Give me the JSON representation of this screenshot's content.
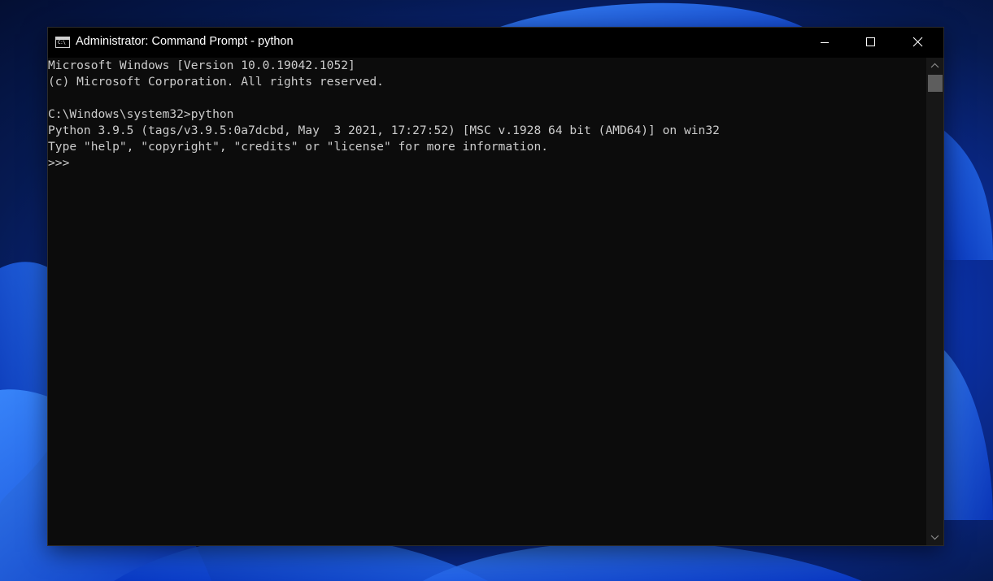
{
  "window": {
    "title": "Administrator: Command Prompt - python",
    "app_icon_text": "C:\\"
  },
  "controls": {
    "minimize_icon": "minimize-icon",
    "maximize_icon": "maximize-icon",
    "close_icon": "close-icon"
  },
  "console": {
    "lines": [
      "Microsoft Windows [Version 10.0.19042.1052]",
      "(c) Microsoft Corporation. All rights reserved.",
      "",
      "C:\\Windows\\system32>python",
      "Python 3.9.5 (tags/v3.9.5:0a7dcbd, May  3 2021, 17:27:52) [MSC v.1928 64 bit (AMD64)] on win32",
      "Type \"help\", \"copyright\", \"credits\" or \"license\" for more information.",
      ">>>"
    ]
  },
  "colors": {
    "console_bg": "#0c0c0c",
    "console_text": "#cccccc",
    "titlebar_bg": "#000000",
    "desktop_accent": "#1a63ff"
  }
}
